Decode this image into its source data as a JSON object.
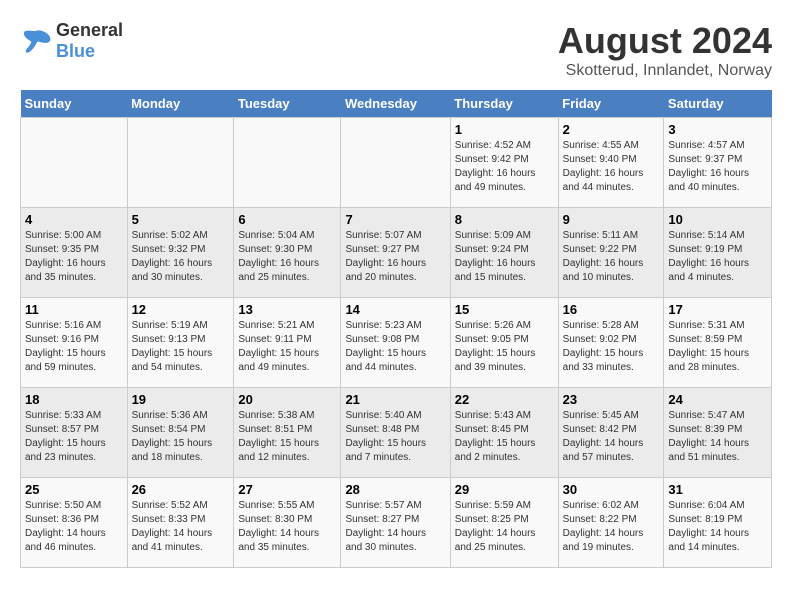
{
  "logo": {
    "text_general": "General",
    "text_blue": "Blue"
  },
  "title": "August 2024",
  "subtitle": "Skotterud, Innlandet, Norway",
  "days_of_week": [
    "Sunday",
    "Monday",
    "Tuesday",
    "Wednesday",
    "Thursday",
    "Friday",
    "Saturday"
  ],
  "weeks": [
    [
      {
        "day": "",
        "info": ""
      },
      {
        "day": "",
        "info": ""
      },
      {
        "day": "",
        "info": ""
      },
      {
        "day": "",
        "info": ""
      },
      {
        "day": "1",
        "info": "Sunrise: 4:52 AM\nSunset: 9:42 PM\nDaylight: 16 hours\nand 49 minutes."
      },
      {
        "day": "2",
        "info": "Sunrise: 4:55 AM\nSunset: 9:40 PM\nDaylight: 16 hours\nand 44 minutes."
      },
      {
        "day": "3",
        "info": "Sunrise: 4:57 AM\nSunset: 9:37 PM\nDaylight: 16 hours\nand 40 minutes."
      }
    ],
    [
      {
        "day": "4",
        "info": "Sunrise: 5:00 AM\nSunset: 9:35 PM\nDaylight: 16 hours\nand 35 minutes."
      },
      {
        "day": "5",
        "info": "Sunrise: 5:02 AM\nSunset: 9:32 PM\nDaylight: 16 hours\nand 30 minutes."
      },
      {
        "day": "6",
        "info": "Sunrise: 5:04 AM\nSunset: 9:30 PM\nDaylight: 16 hours\nand 25 minutes."
      },
      {
        "day": "7",
        "info": "Sunrise: 5:07 AM\nSunset: 9:27 PM\nDaylight: 16 hours\nand 20 minutes."
      },
      {
        "day": "8",
        "info": "Sunrise: 5:09 AM\nSunset: 9:24 PM\nDaylight: 16 hours\nand 15 minutes."
      },
      {
        "day": "9",
        "info": "Sunrise: 5:11 AM\nSunset: 9:22 PM\nDaylight: 16 hours\nand 10 minutes."
      },
      {
        "day": "10",
        "info": "Sunrise: 5:14 AM\nSunset: 9:19 PM\nDaylight: 16 hours\nand 4 minutes."
      }
    ],
    [
      {
        "day": "11",
        "info": "Sunrise: 5:16 AM\nSunset: 9:16 PM\nDaylight: 15 hours\nand 59 minutes."
      },
      {
        "day": "12",
        "info": "Sunrise: 5:19 AM\nSunset: 9:13 PM\nDaylight: 15 hours\nand 54 minutes."
      },
      {
        "day": "13",
        "info": "Sunrise: 5:21 AM\nSunset: 9:11 PM\nDaylight: 15 hours\nand 49 minutes."
      },
      {
        "day": "14",
        "info": "Sunrise: 5:23 AM\nSunset: 9:08 PM\nDaylight: 15 hours\nand 44 minutes."
      },
      {
        "day": "15",
        "info": "Sunrise: 5:26 AM\nSunset: 9:05 PM\nDaylight: 15 hours\nand 39 minutes."
      },
      {
        "day": "16",
        "info": "Sunrise: 5:28 AM\nSunset: 9:02 PM\nDaylight: 15 hours\nand 33 minutes."
      },
      {
        "day": "17",
        "info": "Sunrise: 5:31 AM\nSunset: 8:59 PM\nDaylight: 15 hours\nand 28 minutes."
      }
    ],
    [
      {
        "day": "18",
        "info": "Sunrise: 5:33 AM\nSunset: 8:57 PM\nDaylight: 15 hours\nand 23 minutes."
      },
      {
        "day": "19",
        "info": "Sunrise: 5:36 AM\nSunset: 8:54 PM\nDaylight: 15 hours\nand 18 minutes."
      },
      {
        "day": "20",
        "info": "Sunrise: 5:38 AM\nSunset: 8:51 PM\nDaylight: 15 hours\nand 12 minutes."
      },
      {
        "day": "21",
        "info": "Sunrise: 5:40 AM\nSunset: 8:48 PM\nDaylight: 15 hours\nand 7 minutes."
      },
      {
        "day": "22",
        "info": "Sunrise: 5:43 AM\nSunset: 8:45 PM\nDaylight: 15 hours\nand 2 minutes."
      },
      {
        "day": "23",
        "info": "Sunrise: 5:45 AM\nSunset: 8:42 PM\nDaylight: 14 hours\nand 57 minutes."
      },
      {
        "day": "24",
        "info": "Sunrise: 5:47 AM\nSunset: 8:39 PM\nDaylight: 14 hours\nand 51 minutes."
      }
    ],
    [
      {
        "day": "25",
        "info": "Sunrise: 5:50 AM\nSunset: 8:36 PM\nDaylight: 14 hours\nand 46 minutes."
      },
      {
        "day": "26",
        "info": "Sunrise: 5:52 AM\nSunset: 8:33 PM\nDaylight: 14 hours\nand 41 minutes."
      },
      {
        "day": "27",
        "info": "Sunrise: 5:55 AM\nSunset: 8:30 PM\nDaylight: 14 hours\nand 35 minutes."
      },
      {
        "day": "28",
        "info": "Sunrise: 5:57 AM\nSunset: 8:27 PM\nDaylight: 14 hours\nand 30 minutes."
      },
      {
        "day": "29",
        "info": "Sunrise: 5:59 AM\nSunset: 8:25 PM\nDaylight: 14 hours\nand 25 minutes."
      },
      {
        "day": "30",
        "info": "Sunrise: 6:02 AM\nSunset: 8:22 PM\nDaylight: 14 hours\nand 19 minutes."
      },
      {
        "day": "31",
        "info": "Sunrise: 6:04 AM\nSunset: 8:19 PM\nDaylight: 14 hours\nand 14 minutes."
      }
    ]
  ]
}
